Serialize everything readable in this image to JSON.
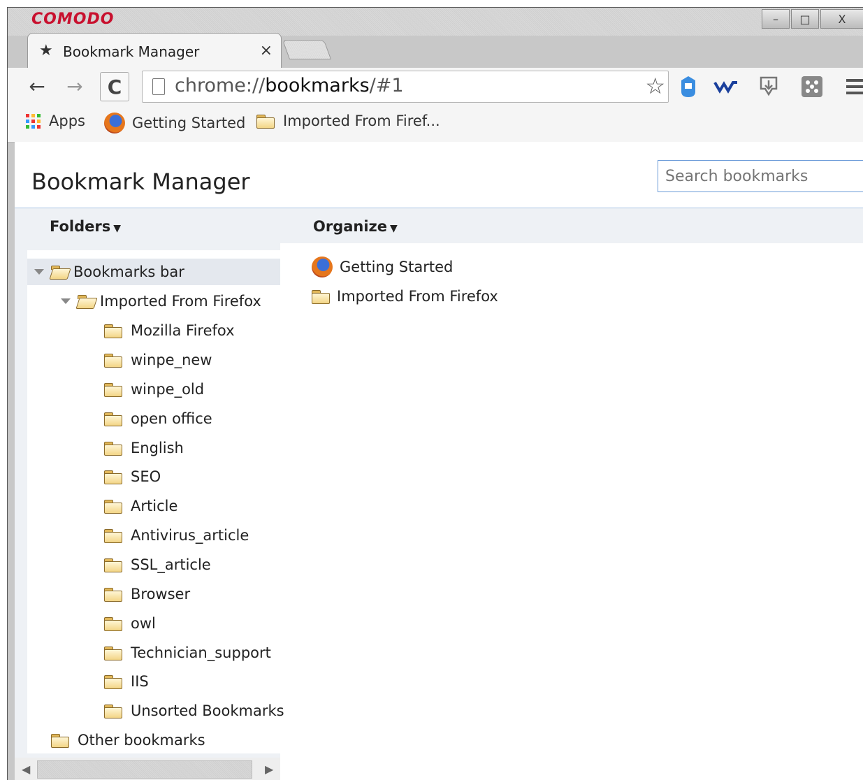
{
  "window": {
    "brand": "COMODO",
    "controls": {
      "minimize": "–",
      "maximize": "□",
      "close": "X"
    }
  },
  "tab": {
    "title": "Bookmark Manager",
    "close": "×"
  },
  "toolbar": {
    "back": "←",
    "forward": "→",
    "reload": "C",
    "url_scheme": "chrome://",
    "url_host": "bookmarks",
    "url_path": "/#1",
    "bookmark_star": "☆"
  },
  "bookmarks_bar": {
    "items": [
      {
        "label": "Apps",
        "icon": "apps-grid-icon"
      },
      {
        "label": "Getting Started",
        "icon": "firefox-icon"
      },
      {
        "label": "Imported From Firef...",
        "icon": "folder-icon"
      }
    ]
  },
  "page": {
    "title": "Bookmark Manager",
    "search_placeholder": "Search bookmarks",
    "folders_menu": "Folders",
    "organize_menu": "Organize"
  },
  "tree": {
    "root": "Bookmarks bar",
    "imported": "Imported From Firefox",
    "children": [
      "Mozilla Firefox",
      "winpe_new",
      "winpe_old",
      "open office",
      "English",
      "SEO",
      "Article",
      "Antivirus_article",
      "SSL_article",
      "Browser",
      "owl",
      "Technician_support",
      "IIS",
      "Unsorted Bookmarks"
    ],
    "other": "Other bookmarks"
  },
  "list": {
    "items": [
      {
        "label": "Getting Started",
        "icon": "firefox-icon"
      },
      {
        "label": "Imported From Firefox",
        "icon": "folder-icon"
      }
    ]
  },
  "colors": {
    "brand": "#c8102e",
    "header_rule": "#a8c4e5",
    "search_border": "#6a9bd8"
  }
}
